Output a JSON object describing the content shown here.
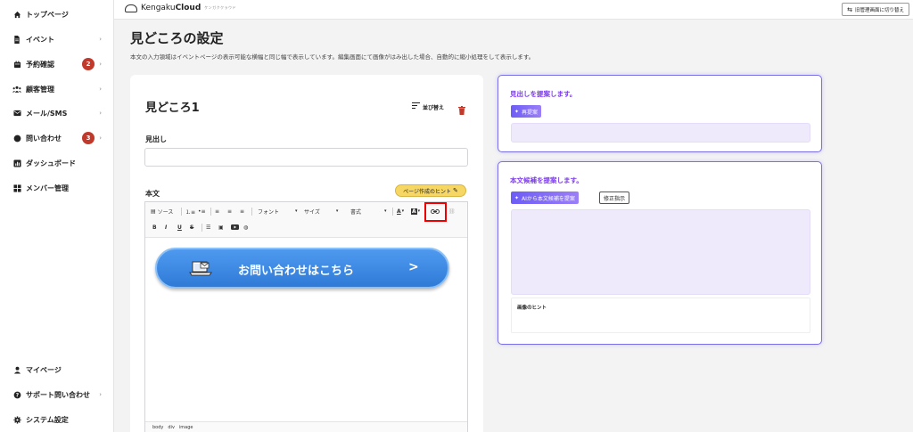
{
  "sidebar": {
    "items": [
      {
        "icon": "home-icon",
        "label": "トップページ"
      },
      {
        "icon": "document-icon",
        "label": "イベント",
        "chevron": "›"
      },
      {
        "icon": "calendar-icon",
        "label": "予約確認",
        "badge": "2",
        "chevron": "›"
      },
      {
        "icon": "users-icon",
        "label": "顧客管理",
        "chevron": "›"
      },
      {
        "icon": "mail-icon",
        "label": "メール/SMS",
        "chevron": "›"
      },
      {
        "icon": "chat-icon",
        "label": "問い合わせ",
        "badge": "3",
        "chevron": "›"
      },
      {
        "icon": "chart-icon",
        "label": "ダッシュボード"
      },
      {
        "icon": "grid-icon",
        "label": "メンバー管理"
      }
    ],
    "bottom_items": [
      {
        "icon": "person-icon",
        "label": "マイページ"
      },
      {
        "icon": "help-icon",
        "label": "サポート問い合わせ",
        "chevron": "›"
      },
      {
        "icon": "gear-icon",
        "label": "システム設定"
      }
    ]
  },
  "topbar": {
    "logo_prefix": "Kengaku",
    "logo_bold": "Cloud",
    "logo_sub": "ケンガククラウド",
    "switch_label": "旧管理画面に切り替え"
  },
  "page": {
    "title": "見どころの設定",
    "description": "本文の入力領域はイベントページの表示可能な横幅と同じ幅で表示しています。編集画面にて画像がはみ出した場合、自動的に縮小処理をして表示します。"
  },
  "card": {
    "title": "見どころ1",
    "sort_label": "並び替え",
    "heading_label": "見出し",
    "heading_value": "",
    "body_label": "本文",
    "hint_button": "ページ作成のヒント"
  },
  "editor": {
    "toolbar_row1": {
      "source": "ソース",
      "font": "フォント",
      "size": "サイズ",
      "format": "書式"
    },
    "toolbar_row2": [
      "B",
      "I",
      "U",
      "S"
    ],
    "cta_text": "お問い合わせはこちら",
    "cta_arrow": ">",
    "status_path": [
      "body",
      "div",
      "image"
    ]
  },
  "headline_panel": {
    "title": "見出しを提案します。",
    "regen_button": "再提案",
    "output": ""
  },
  "body_panel": {
    "title": "本文候補を提案します。",
    "ai_button": "AIから本文候補を提案",
    "revise_button": "修正指示",
    "output": "",
    "image_hint_label": "画像のヒント"
  },
  "colors": {
    "accent_purple": "#7c3aed",
    "badge_red": "#c0392b",
    "cta_blue": "#2f7ad6",
    "hint_yellow": "#f7d764"
  }
}
